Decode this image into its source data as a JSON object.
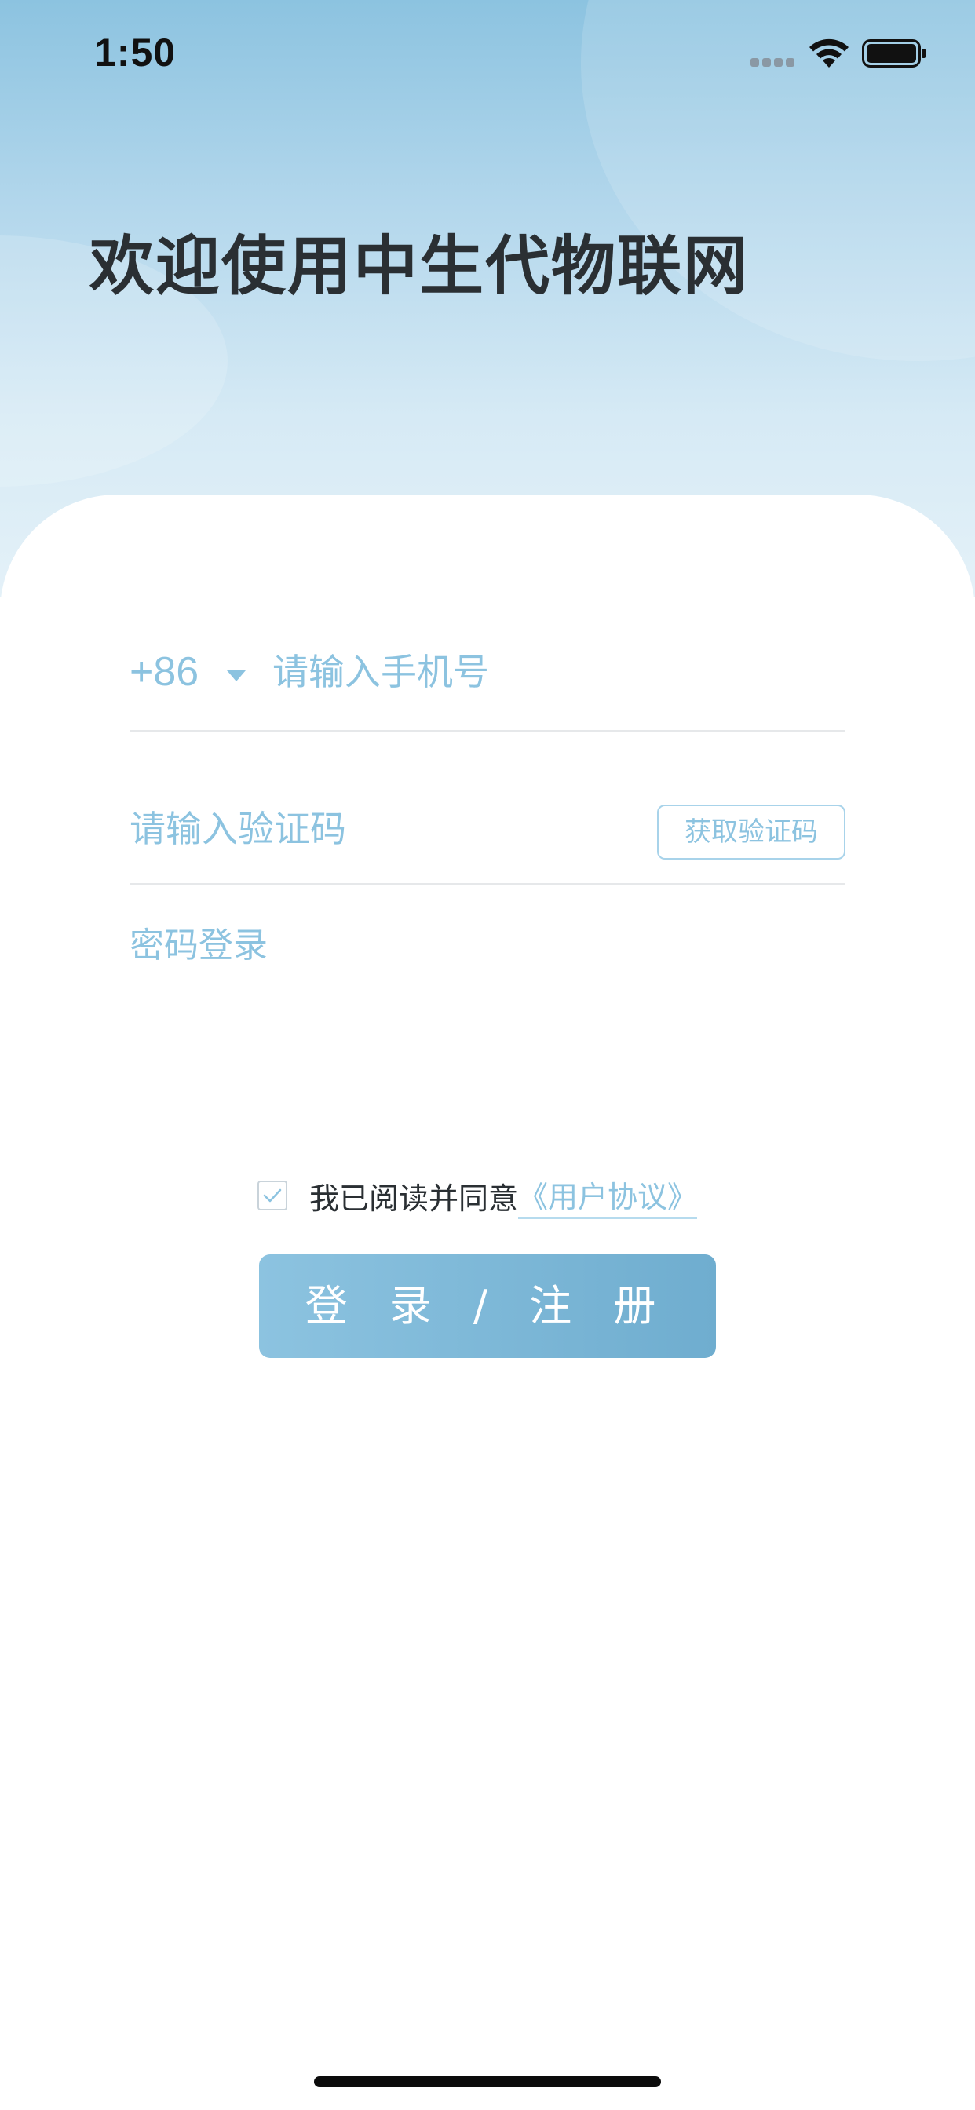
{
  "status_bar": {
    "time": "1:50"
  },
  "header": {
    "title": "欢迎使用中生代物联网"
  },
  "phone": {
    "country_code": "+86",
    "placeholder": "请输入手机号"
  },
  "verification": {
    "placeholder": "请输入验证码",
    "get_code_label": "获取验证码"
  },
  "password_login_label": "密码登录",
  "agreement": {
    "checked": true,
    "text": "我已阅读并同意",
    "link_text": "《用户协议》"
  },
  "login_button_label": "登 录 / 注 册",
  "colors": {
    "accent": "#8cc3e0",
    "title_text": "#2a2f33",
    "button_gradient_end": "#6fadcf"
  },
  "icons": {
    "signal": "cellular-signal-icon",
    "wifi": "wifi-icon",
    "battery": "battery-icon",
    "dropdown": "triangle-down-icon",
    "checkbox": "checkmark-icon"
  }
}
